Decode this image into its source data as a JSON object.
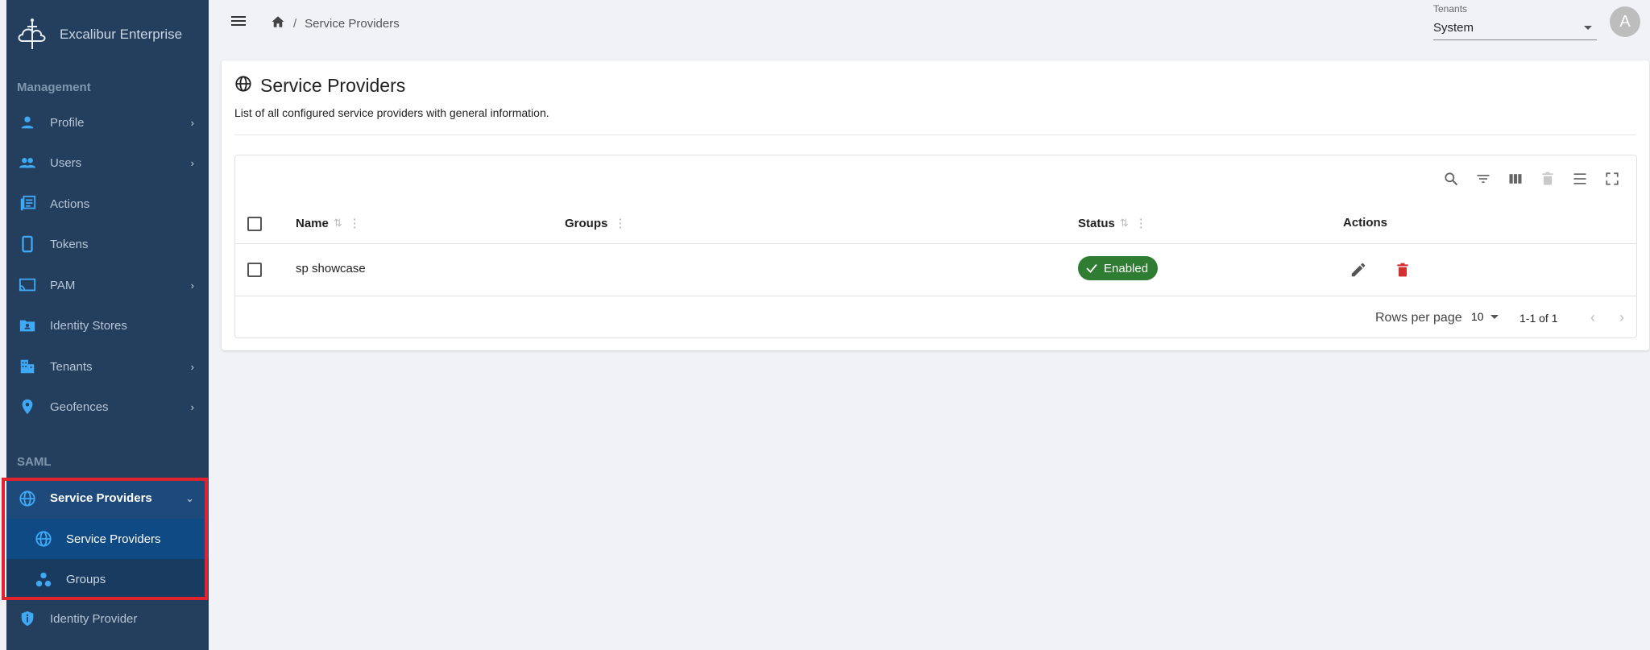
{
  "app": {
    "name": "Excalibur Enterprise"
  },
  "sidebar": {
    "sections": [
      {
        "label": "Management"
      },
      {
        "label": "SAML"
      }
    ],
    "items": [
      {
        "label": "Profile",
        "icon": "person-icon",
        "has_submenu": true
      },
      {
        "label": "Users",
        "icon": "people-icon",
        "has_submenu": true
      },
      {
        "label": "Actions",
        "icon": "list-icon",
        "has_submenu": false
      },
      {
        "label": "Tokens",
        "icon": "phone-icon",
        "has_submenu": false
      },
      {
        "label": "PAM",
        "icon": "cast-icon",
        "has_submenu": true
      },
      {
        "label": "Identity Stores",
        "icon": "folder-icon",
        "has_submenu": false
      },
      {
        "label": "Tenants",
        "icon": "building-icon",
        "has_submenu": true
      },
      {
        "label": "Geofences",
        "icon": "location-icon",
        "has_submenu": true
      },
      {
        "label": "Service Providers",
        "icon": "globe-icon",
        "has_submenu": true,
        "expanded": true
      },
      {
        "label": "Service Providers",
        "icon": "globe-icon",
        "sub": true
      },
      {
        "label": "Groups",
        "icon": "group-icon",
        "sub": true
      },
      {
        "label": "Identity Provider",
        "icon": "shield-icon",
        "has_submenu": false
      }
    ]
  },
  "header": {
    "breadcrumb": {
      "separator": "/",
      "current": "Service Providers"
    },
    "tenants": {
      "label": "Tenants",
      "value": "System"
    },
    "avatar_initial": "A"
  },
  "page": {
    "title": "Service Providers",
    "subtitle": "List of all configured service providers with general information."
  },
  "table": {
    "columns": [
      {
        "label": "Name",
        "sortable": true
      },
      {
        "label": "Groups",
        "sortable": false
      },
      {
        "label": "Status",
        "sortable": true
      },
      {
        "label": "Actions",
        "sortable": false
      }
    ],
    "rows": [
      {
        "name": "sp showcase",
        "groups": "",
        "status": "Enabled"
      }
    ],
    "footer": {
      "rows_per_page_label": "Rows per page",
      "rows_per_page": "10",
      "range": "1-1 of 1"
    }
  },
  "colors": {
    "sidebar_bg": "#243f5e",
    "accent": "#3fa9f5",
    "status_enabled": "#2e7d32",
    "delete": "#d32f2f",
    "highlight": "#e0232e"
  }
}
